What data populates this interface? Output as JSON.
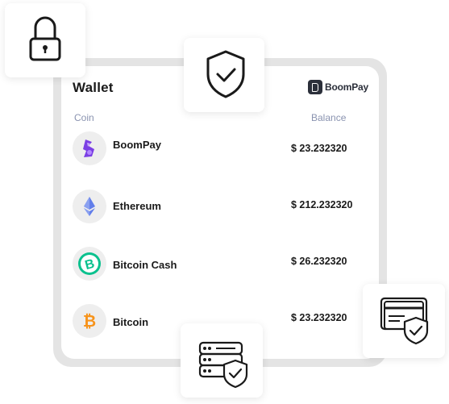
{
  "wallet": {
    "title": "Wallet",
    "brand": "BoomPay",
    "columns": {
      "coin": "Coin",
      "balance": "Balance"
    },
    "coins": [
      {
        "name": "BoomPay",
        "balance": "$ 23.232320",
        "icon": "boompay-icon",
        "color": "#7b3fe4"
      },
      {
        "name": "Ethereum",
        "balance": "$ 212.232320",
        "icon": "ethereum-icon",
        "color": "#627eea"
      },
      {
        "name": "Bitcoin Cash",
        "balance": "$ 26.232320",
        "icon": "bitcoin-cash-icon",
        "color": "#0ac18e"
      },
      {
        "name": "Bitcoin",
        "balance": "$ 23.232320",
        "icon": "bitcoin-icon",
        "color": "#f7931a"
      }
    ]
  },
  "badges": [
    {
      "icon": "padlock-icon"
    },
    {
      "icon": "shield-check-icon"
    },
    {
      "icon": "server-shield-icon"
    },
    {
      "icon": "cards-shield-icon"
    }
  ]
}
